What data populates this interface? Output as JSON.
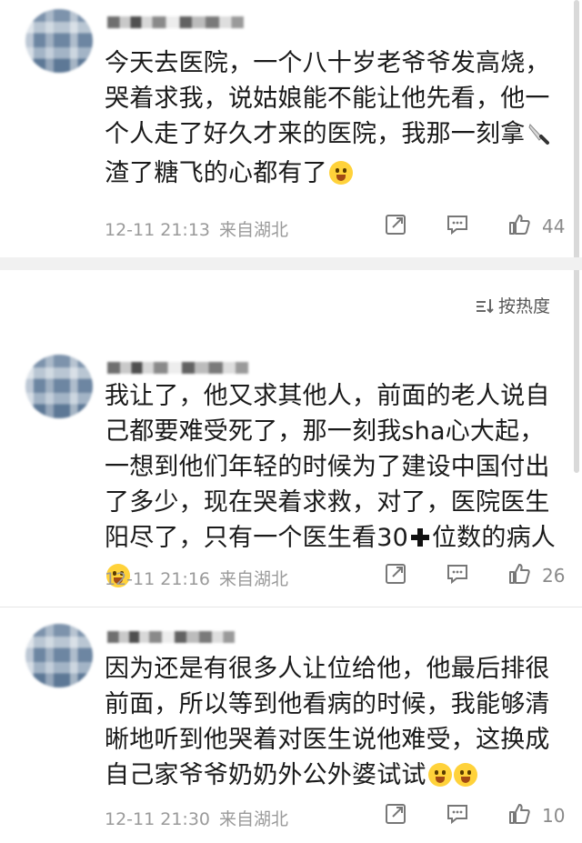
{
  "comments": [
    {
      "text_part1": "今天去医院，一个八十岁老爷爷发高烧，哭着求我，说姑娘能不能让他先看，他一个人走了好久才来的医院，我那一刻拿",
      "text_part2": "渣了糖飞的心都有了",
      "date": "12-11 21:13",
      "location": "来自湖北",
      "likes": "44"
    },
    {
      "text_part1": "我让了，他又求其他人，前面的老人说自己都要难受死了，那一刻我sha心大起，一想到他们年轻的时候为了建设中国付出了多少，现在哭着求救，对了，医院医生阳尽了，只有一个医生看30",
      "text_part2": "位数的病人",
      "date": "12-11 21:16",
      "location": "来自湖北",
      "likes": "26"
    },
    {
      "text_part1": "因为还是有很多人让位给他，他最后排很前面，所以等到他看病的时候，我能够清晰地听到他哭着对医生说他难受，这换成自己家爷爷奶奶外公外婆试试",
      "date": "12-11 21:30",
      "location": "来自湖北",
      "likes": "10"
    }
  ],
  "sort": {
    "label": "按热度"
  },
  "icons": {
    "share": "share-icon",
    "comment": "comment-icon",
    "like": "thumbs-up-icon",
    "sort": "sort-icon",
    "knife": "knife-emoji-icon",
    "plus": "plus-emoji-icon",
    "face": "face-emoji-icon"
  },
  "colors": {
    "text": "#1a1a1a",
    "meta": "#9a9a9a",
    "divider": "#f1f1f1"
  }
}
